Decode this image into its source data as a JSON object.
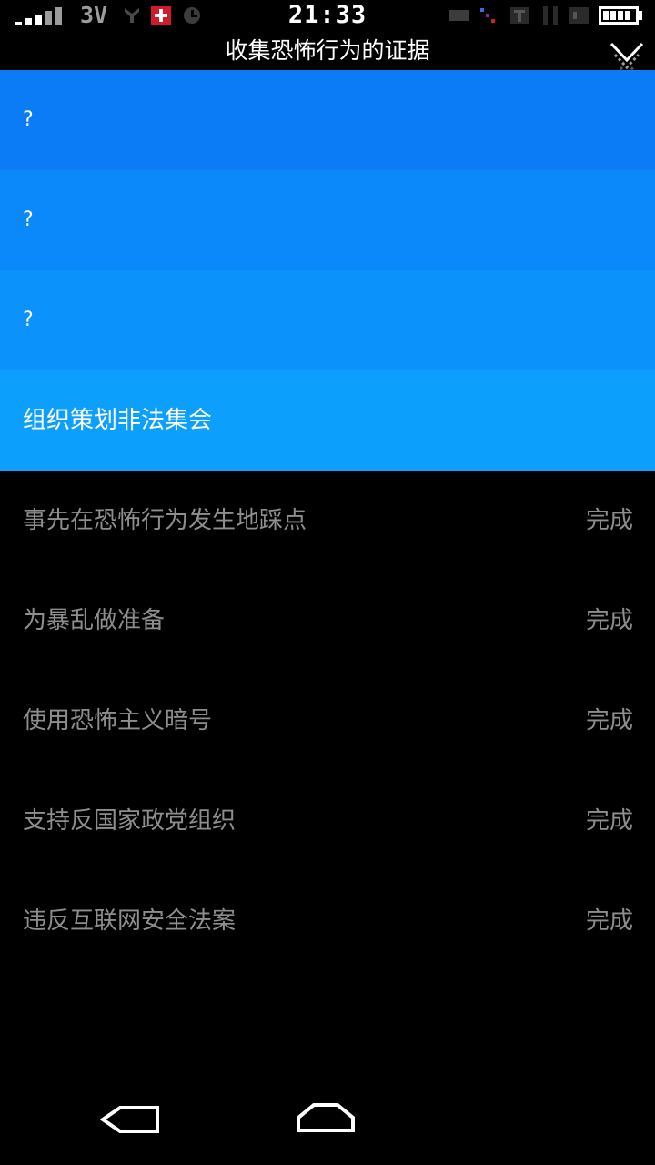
{
  "status_bar": {
    "time": "21:33",
    "network": "3V",
    "icons": [
      "signal-icon",
      "usb-icon",
      "swiss-flag-icon",
      "alarm-icon",
      "notification-icon",
      "battery-icon"
    ]
  },
  "header": {
    "title": "收集恐怖行为的证据",
    "collapse_icon": "chevron-down-icon"
  },
  "tasks": [
    {
      "label": "?",
      "status": "",
      "state": "locked",
      "color": "#0b7cf5"
    },
    {
      "label": "?",
      "status": "",
      "state": "locked",
      "color": "#0b88fa"
    },
    {
      "label": "?",
      "status": "",
      "state": "locked",
      "color": "#0b93fb"
    },
    {
      "label": "组织策划非法集会",
      "status": "",
      "state": "active",
      "color": "#0c9ffb"
    },
    {
      "label": "事先在恐怖行为发生地踩点",
      "status": "完成",
      "state": "done"
    },
    {
      "label": "为暴乱做准备",
      "status": "完成",
      "state": "done"
    },
    {
      "label": "使用恐怖主义暗号",
      "status": "完成",
      "state": "done"
    },
    {
      "label": "支持反国家政党组织",
      "status": "完成",
      "state": "done"
    },
    {
      "label": "违反互联网安全法案",
      "status": "完成",
      "state": "done"
    }
  ],
  "nav": {
    "back_icon": "back-icon",
    "home_icon": "home-icon"
  }
}
